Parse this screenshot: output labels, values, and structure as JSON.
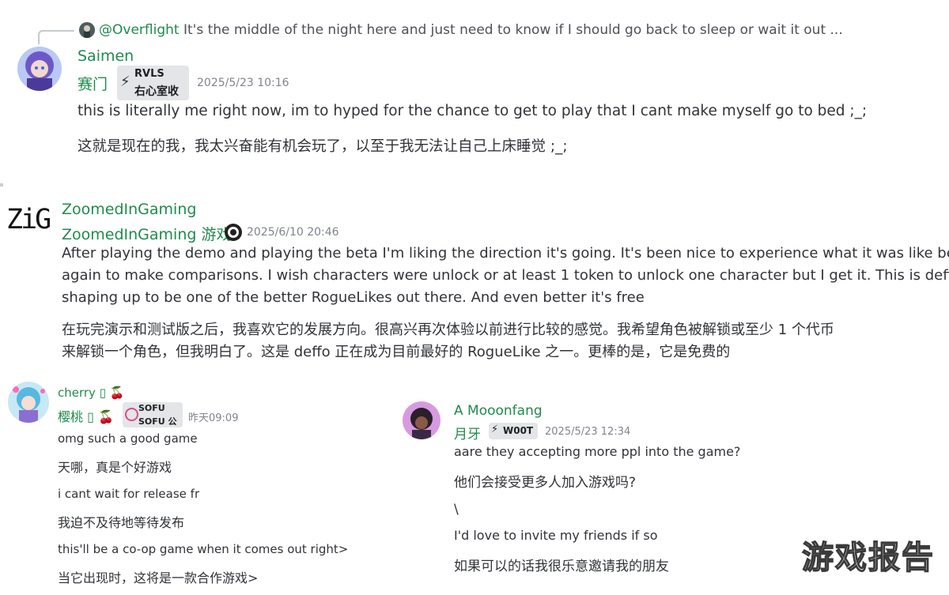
{
  "colors": {
    "username": "#1f8b4c",
    "text": "#313338",
    "timestamp": "#80848e",
    "tag_bg": "#e3e5e8"
  },
  "msg1": {
    "reply_user": "@Overflight",
    "reply_text": "It's the middle of the night here and just need to know if I should go back to sleep or wait it out ...",
    "username": "Saimen",
    "username_cn": "赛门",
    "tag_top": "RVLS",
    "tag_bottom": "右心室收",
    "timestamp": "2025/5/23 10:16",
    "text": "this is literally me right now, im to hyped for the chance to get to play that I cant make myself go to bed ;_;",
    "text_cn": "这就是现在的我，我太兴奋能有机会玩了，以至于我无法让自己上床睡觉 ;_;"
  },
  "msg2": {
    "avatar_text": "ZiG",
    "username": "ZoomedInGaming",
    "username_cn": "ZoomedInGaming 游戏",
    "timestamp": "2025/6/10 20:46",
    "text_lines": [
      "After playing the demo and playing the beta I'm liking the direction it's going. It's been nice to experience what it was like before",
      "again to make comparisons. I wish characters were unlock or at least 1 token to unlock one character but I get it. This is deffo",
      "shaping up to be one of the better RogueLikes out there. And even better it's free"
    ],
    "text_cn_lines": [
      "在玩完演示和测试版之后，我喜欢它的发展方向。很高兴再次体验以前进行比较的感觉。我希望角色被解锁或至少 1 个代币",
      "来解锁一个角色，但我明白了。这是 deffo 正在成为目前最好的 RogueLike 之一。更棒的是，它是免费的"
    ]
  },
  "msg3": {
    "username": "cherry ▯",
    "username_cn": "樱桃 ▯",
    "tag_top": "SOFU",
    "tag_bottom": "SOFU 公",
    "timestamp": "昨天09:09",
    "lines": [
      {
        "en": "omg such a good game",
        "cn": "天哪，真是个好游戏"
      },
      {
        "en": "i cant wait for release fr",
        "cn": "我迫不及待地等待发布"
      },
      {
        "en": "this'll be a co-op game when it comes out right>",
        "cn": "当它出现时，这将是一款合作游戏>"
      }
    ]
  },
  "msg4": {
    "username": "A Mooonfang",
    "username_cn": "月牙",
    "tag": "W00T",
    "timestamp": "2025/5/23 12:34",
    "text": "aare they accepting more ppl into the game?",
    "text_cn": "他们会接受更多人加入游戏吗?",
    "backslash": "\\",
    "text2": "I'd love to invite my friends if so",
    "text2_cn": "如果可以的话我很乐意邀请我的朋友"
  },
  "watermark": "游戏报告"
}
